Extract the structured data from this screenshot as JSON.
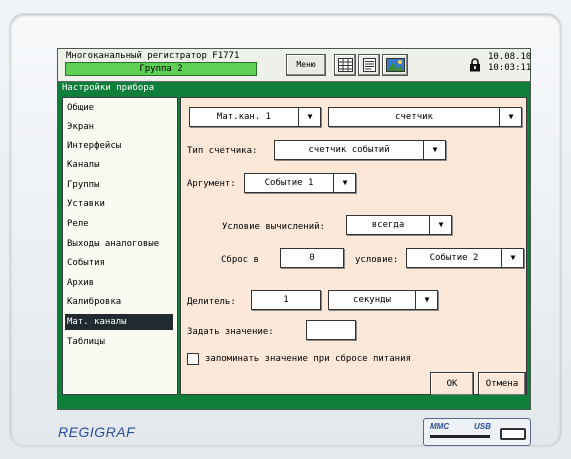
{
  "topbar": {
    "title": "Многоканальный регистратор F1771",
    "group": "Группа 2",
    "menu_label": "Меню",
    "date": "10.08.10",
    "time": "10:03:11"
  },
  "header": {
    "title": "Настройки прибора"
  },
  "sidebar": {
    "items": [
      {
        "label": "Общие"
      },
      {
        "label": "Экран"
      },
      {
        "label": "Интерфейсы"
      },
      {
        "label": "Каналы"
      },
      {
        "label": "Группы"
      },
      {
        "label": "Уставки"
      },
      {
        "label": "Реле"
      },
      {
        "label": "Выходы аналоговые"
      },
      {
        "label": "События"
      },
      {
        "label": "Архив"
      },
      {
        "label": "Калибровка"
      },
      {
        "label": "Мат. каналы"
      },
      {
        "label": "Таблицы"
      }
    ],
    "active_index": 11
  },
  "content": {
    "channel_select": "Мат.кан. 1",
    "mode_select": "счетчик",
    "counter_type_label": "Тип счетчика:",
    "counter_type_value": "счетчик событий",
    "argument_label": "Аргумент:",
    "argument_value": "Событие 1",
    "condition_label": "Условие вычислений:",
    "condition_value": "всегда",
    "reset_label": "Сброс в",
    "reset_value": "0",
    "reset_condition_label": "условие:",
    "reset_condition_value": "Событие 2",
    "divisor_label": "Делитель:",
    "divisor_value": "1",
    "divisor_unit": "секунды",
    "set_value_label": "Задать значение:",
    "set_value_value": "",
    "remember_label": "запоминать значение при сбросе питания",
    "ok_label": "OK",
    "cancel_label": "Отмена"
  },
  "bezel": {
    "brand": "REGIGRAF",
    "mmc_label": "MMC",
    "usb_label": "USB"
  },
  "colors": {
    "screen_green": "#0e7f3a",
    "group_green": "#5fcf55",
    "content_bg": "#fbe8d9",
    "brand_blue": "#2a4f9a"
  }
}
